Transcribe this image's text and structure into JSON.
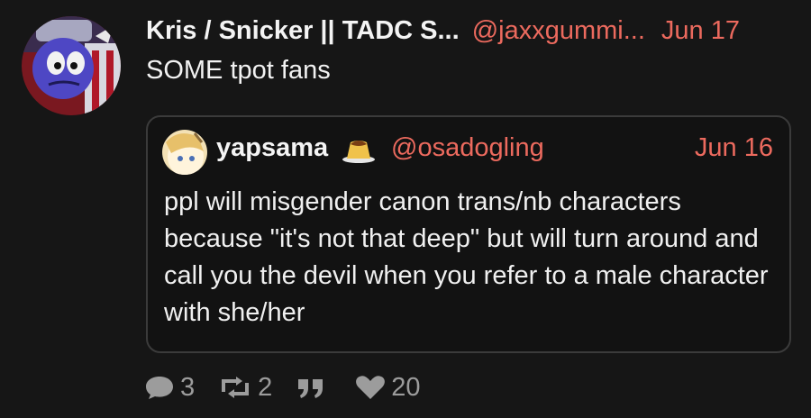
{
  "post": {
    "author_name": "Kris / Snicker || TADC S...",
    "handle": "@jaxxgummi...",
    "date": "Jun 17",
    "text": "SOME tpot fans"
  },
  "quote": {
    "author_name": "yapsama",
    "author_emoji": "pudding-icon",
    "handle": "@osadogling",
    "date": "Jun 16",
    "text": "ppl will misgender canon trans/nb characters because \"it's not that deep\" but will turn around and call you the devil when you refer to a male character with she/her"
  },
  "actions": {
    "replies": "3",
    "reposts": "2",
    "quotes": "",
    "likes": "20"
  },
  "colors": {
    "background": "#161616",
    "accent": "#ec6a5e",
    "muted": "#9c9c9c",
    "border": "#3b3b3b"
  }
}
